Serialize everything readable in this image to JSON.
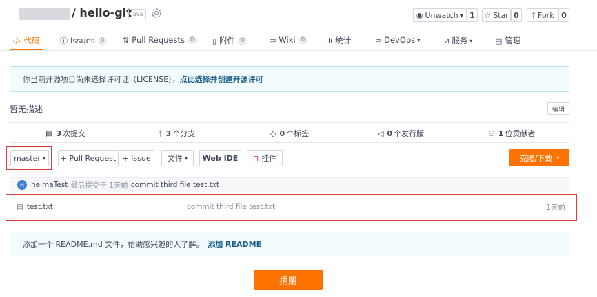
{
  "header": {
    "owner": "",
    "repo_name": "hello-git",
    "lang_tag": "Java",
    "unwatch_label": "Unwatch",
    "unwatch_caret": "▾",
    "unwatch_count": "1",
    "star_label": "Star",
    "star_count": "0",
    "fork_label": "Fork",
    "fork_count": "0"
  },
  "tabs": [
    {
      "label": "代码",
      "icon": "code-icon"
    },
    {
      "label": "Issues",
      "count": "0",
      "icon": "issue-icon"
    },
    {
      "label": "Pull Requests",
      "count": "0",
      "icon": "pull-request-icon"
    },
    {
      "label": "附件",
      "count": "0",
      "icon": "attachment-icon"
    },
    {
      "label": "Wiki",
      "count": "0",
      "icon": "wiki-icon"
    },
    {
      "label": "统计",
      "icon": "chart-icon"
    },
    {
      "label": "DevOps",
      "icon": "devops-icon"
    },
    {
      "label": "服务",
      "icon": "service-icon"
    },
    {
      "label": "管理",
      "icon": "manage-icon"
    }
  ],
  "license_notice": {
    "text": "你当前开源项目尚未选择许可证（LICENSE），",
    "link": "点此选择并创建开源许可"
  },
  "description": {
    "text": "暂无描述",
    "edit_label": "编辑"
  },
  "stats": {
    "commits_count": "3",
    "commits_label": "次提交",
    "branches_count": "3",
    "branches_label": "个分支",
    "tags_count": "0",
    "tags_label": "个标签",
    "releases_count": "0",
    "releases_label": "个发行版",
    "contributors_count": "1",
    "contributors_label": "位贡献者"
  },
  "toolbar": {
    "branch": "master",
    "pull_request": "+ Pull Request",
    "issue": "+ Issue",
    "file": "文件",
    "web_ide": "Web IDE",
    "widget": "挂件",
    "clone": "克隆/下载"
  },
  "last_commit": {
    "avatar_letter": "H",
    "author": "heimaTest",
    "meta": "最后提交于 1天前",
    "message": "commit third file test.txt"
  },
  "files": [
    {
      "name": "test.txt",
      "commit": "commit third file test.txt",
      "time": "1天前"
    }
  ],
  "readme_notice": {
    "text": "添加一个 README.md 文件，帮助感兴趣的人了解。",
    "link": "添加 README"
  },
  "donate_label": "捐赠",
  "colors": {
    "accent": "#fe7300",
    "highlight_border": "#e0393e",
    "notice_bg": "#f2fbfd",
    "notice_border": "#b7e4ef"
  }
}
